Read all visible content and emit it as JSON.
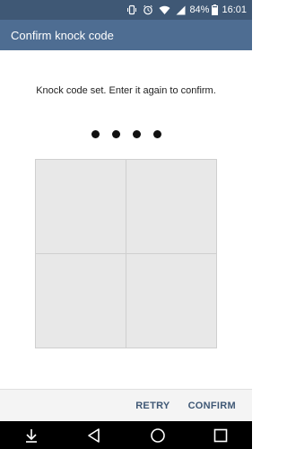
{
  "status_bar": {
    "battery_percent": "84%",
    "time": "16:01",
    "icons": [
      "vibrate-icon",
      "alarm-icon",
      "wifi-icon",
      "signal-icon",
      "battery-icon"
    ]
  },
  "app_bar": {
    "title": "Confirm knock code"
  },
  "main": {
    "instruction": "Knock code set. Enter it again to confirm.",
    "entered_dots": 4
  },
  "footer": {
    "retry_label": "RETRY",
    "confirm_label": "CONFIRM"
  },
  "nav_bar": {
    "icons": [
      "download-icon",
      "back-icon",
      "home-icon",
      "recents-icon"
    ]
  },
  "colors": {
    "status_bar": "#3f5875",
    "app_bar": "#4e6d92",
    "accent_text": "#3f5875",
    "grid_fill": "#e8e8e8"
  }
}
